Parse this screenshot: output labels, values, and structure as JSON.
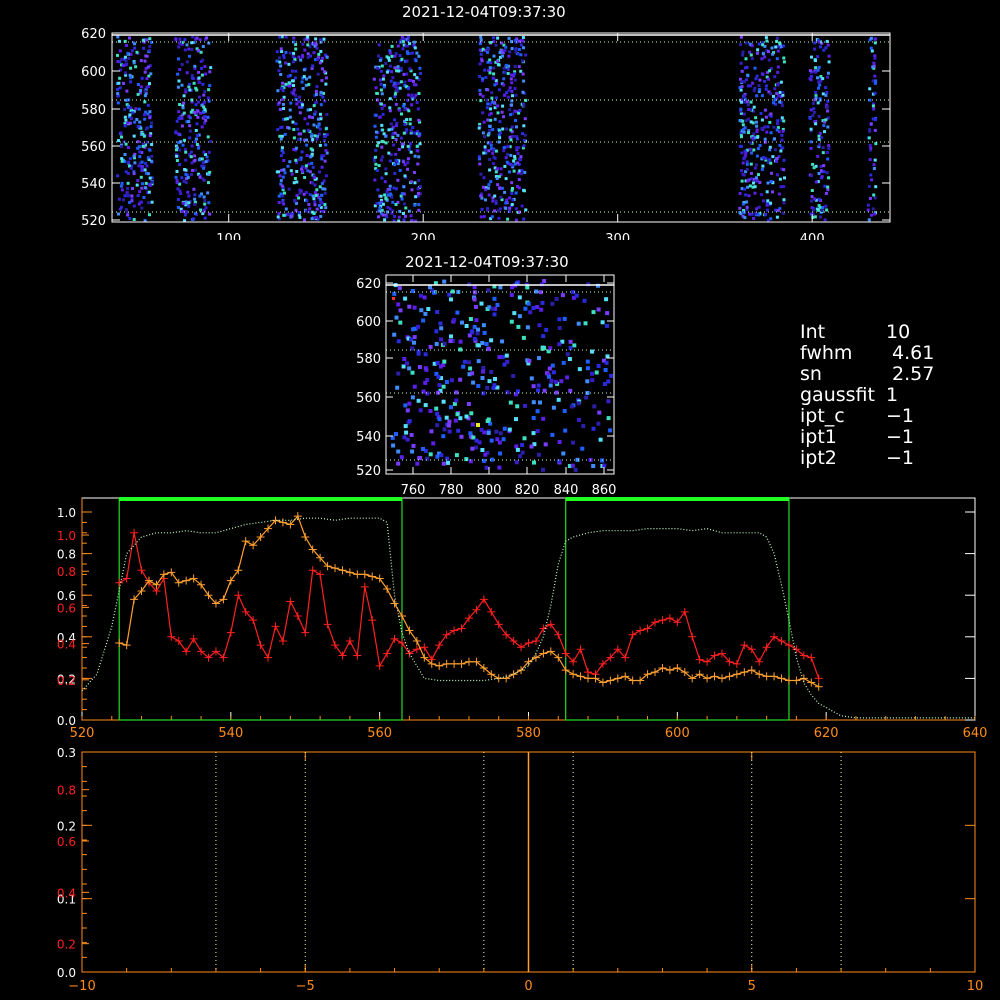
{
  "panels": {
    "top_image": {
      "title": "2021-12-04T09:37:30",
      "x_ticks": [
        "100",
        "200",
        "300",
        "400"
      ],
      "y_ticks": [
        "520",
        "540",
        "560",
        "580",
        "600",
        "620"
      ]
    },
    "mid_image": {
      "title": "2021-12-04T09:37:30",
      "x_ticks": [
        "760",
        "780",
        "800",
        "820",
        "840",
        "860"
      ],
      "y_ticks": [
        "520",
        "540",
        "560",
        "580",
        "600",
        "620"
      ]
    }
  },
  "stats": [
    {
      "key": "Int",
      "value": "10"
    },
    {
      "key": "fwhm",
      "value": " 4.61"
    },
    {
      "key": "sn",
      "value": " 2.57"
    },
    {
      "key": "gaussfit",
      "value": "1"
    },
    {
      "key": "ipt_c",
      "value": "−1"
    },
    {
      "key": "ipt1",
      "value": "−1"
    },
    {
      "key": "ipt2",
      "value": "−1"
    }
  ],
  "colors": {
    "axis_white": "#ffffff",
    "axis_orange": "#ff8c1a",
    "red_series": "#ff2020",
    "orange_series": "#ffa030",
    "green_box": "#22dd22",
    "bright_green_bar": "#22ff22",
    "dotted_green": "#c8ffc8",
    "dotted_yellow": "#ffff88"
  },
  "chart_data": [
    {
      "type": "line",
      "xlim": [
        520,
        640
      ],
      "ylim": [
        0,
        1.0
      ],
      "x_ticks": [
        "520",
        "540",
        "560",
        "580",
        "600",
        "620",
        "640"
      ],
      "y_ticks_white": [
        "0.0",
        "0.2",
        "0.4",
        "0.6",
        "0.8",
        "1.0"
      ],
      "y_ticks_red": [
        "0.2",
        "0.4",
        "0.6",
        "0.8",
        "1.0"
      ],
      "boxes": [
        [
          525,
          563
        ],
        [
          585,
          615
        ]
      ],
      "series": [
        {
          "color": "red",
          "x": [
            525,
            526,
            527,
            528,
            529,
            530,
            531,
            532,
            533,
            534,
            535,
            536,
            537,
            538,
            539,
            540,
            541,
            542,
            543,
            544,
            545,
            546,
            547,
            548,
            549,
            550,
            551,
            552,
            553,
            554,
            555,
            556,
            557,
            558,
            559,
            560,
            561,
            562,
            563,
            564,
            565,
            566,
            567,
            568,
            569,
            570,
            571,
            572,
            573,
            574,
            575,
            576,
            577,
            578,
            579,
            580,
            581,
            582,
            583,
            584,
            585,
            586,
            587,
            588,
            589,
            590,
            591,
            592,
            593,
            594,
            595,
            596,
            597,
            598,
            599,
            600,
            601,
            602,
            603,
            604,
            605,
            606,
            607,
            608,
            609,
            610,
            611,
            612,
            613,
            614,
            615,
            616,
            617,
            618,
            619
          ],
          "y": [
            0.66,
            0.68,
            0.9,
            0.72,
            0.66,
            0.62,
            0.68,
            0.4,
            0.38,
            0.33,
            0.39,
            0.33,
            0.3,
            0.33,
            0.3,
            0.42,
            0.6,
            0.52,
            0.48,
            0.36,
            0.3,
            0.45,
            0.38,
            0.57,
            0.5,
            0.42,
            0.72,
            0.7,
            0.46,
            0.36,
            0.31,
            0.38,
            0.31,
            0.64,
            0.48,
            0.26,
            0.32,
            0.39,
            0.37,
            0.32,
            0.34,
            0.35,
            0.29,
            0.36,
            0.41,
            0.43,
            0.44,
            0.49,
            0.53,
            0.58,
            0.52,
            0.46,
            0.41,
            0.38,
            0.35,
            0.37,
            0.38,
            0.44,
            0.46,
            0.41,
            0.32,
            0.28,
            0.34,
            0.23,
            0.22,
            0.27,
            0.3,
            0.34,
            0.3,
            0.41,
            0.43,
            0.44,
            0.47,
            0.48,
            0.49,
            0.47,
            0.52,
            0.4,
            0.29,
            0.28,
            0.31,
            0.32,
            0.28,
            0.27,
            0.36,
            0.34,
            0.28,
            0.35,
            0.4,
            0.38,
            0.36,
            0.34,
            0.31,
            0.3,
            0.2
          ]
        },
        {
          "color": "orange",
          "x": [
            525,
            526,
            527,
            528,
            529,
            530,
            531,
            532,
            533,
            534,
            535,
            536,
            537,
            538,
            539,
            540,
            541,
            542,
            543,
            544,
            545,
            546,
            547,
            548,
            549,
            550,
            551,
            552,
            553,
            554,
            555,
            556,
            557,
            558,
            559,
            560,
            561,
            562,
            563,
            564,
            565,
            566,
            567,
            568,
            569,
            570,
            571,
            572,
            573,
            574,
            575,
            576,
            577,
            578,
            579,
            580,
            581,
            582,
            583,
            584,
            585,
            586,
            587,
            588,
            589,
            590,
            591,
            592,
            593,
            594,
            595,
            596,
            597,
            598,
            599,
            600,
            601,
            602,
            603,
            604,
            605,
            606,
            607,
            608,
            609,
            610,
            611,
            612,
            613,
            614,
            615,
            616,
            617,
            618,
            619
          ],
          "y": [
            0.37,
            0.36,
            0.58,
            0.62,
            0.67,
            0.65,
            0.7,
            0.71,
            0.66,
            0.67,
            0.68,
            0.65,
            0.6,
            0.56,
            0.58,
            0.67,
            0.72,
            0.86,
            0.84,
            0.88,
            0.92,
            0.96,
            0.95,
            0.94,
            0.98,
            0.88,
            0.82,
            0.78,
            0.74,
            0.73,
            0.72,
            0.71,
            0.7,
            0.7,
            0.69,
            0.68,
            0.63,
            0.56,
            0.5,
            0.43,
            0.38,
            0.3,
            0.27,
            0.26,
            0.27,
            0.27,
            0.27,
            0.28,
            0.28,
            0.25,
            0.22,
            0.2,
            0.2,
            0.22,
            0.24,
            0.28,
            0.3,
            0.32,
            0.33,
            0.3,
            0.24,
            0.22,
            0.21,
            0.2,
            0.2,
            0.18,
            0.19,
            0.2,
            0.21,
            0.19,
            0.19,
            0.22,
            0.23,
            0.25,
            0.24,
            0.25,
            0.23,
            0.2,
            0.22,
            0.2,
            0.21,
            0.2,
            0.21,
            0.22,
            0.23,
            0.24,
            0.22,
            0.21,
            0.21,
            0.2,
            0.19,
            0.19,
            0.2,
            0.18,
            0.16
          ]
        },
        {
          "color": "dotted-green",
          "x": [
            520,
            522,
            524,
            526,
            528,
            530,
            532,
            534,
            536,
            538,
            540,
            542,
            544,
            546,
            548,
            550,
            552,
            554,
            556,
            558,
            560,
            561,
            562,
            563,
            564,
            565,
            566,
            568,
            570,
            572,
            574,
            576,
            578,
            580,
            581,
            582,
            583,
            584,
            585,
            586,
            588,
            590,
            592,
            594,
            596,
            598,
            600,
            602,
            604,
            606,
            608,
            610,
            611,
            612,
            613,
            614,
            615,
            616,
            617,
            618,
            619,
            620,
            621,
            622,
            624,
            628,
            632,
            636,
            640
          ],
          "y": [
            0.14,
            0.22,
            0.45,
            0.8,
            0.88,
            0.9,
            0.9,
            0.91,
            0.9,
            0.9,
            0.92,
            0.94,
            0.95,
            0.96,
            0.96,
            0.97,
            0.97,
            0.96,
            0.97,
            0.97,
            0.97,
            0.95,
            0.6,
            0.42,
            0.32,
            0.26,
            0.2,
            0.19,
            0.19,
            0.19,
            0.19,
            0.2,
            0.22,
            0.26,
            0.32,
            0.4,
            0.55,
            0.75,
            0.86,
            0.88,
            0.9,
            0.91,
            0.91,
            0.91,
            0.92,
            0.92,
            0.92,
            0.91,
            0.92,
            0.9,
            0.9,
            0.9,
            0.9,
            0.88,
            0.8,
            0.65,
            0.48,
            0.3,
            0.18,
            0.12,
            0.08,
            0.06,
            0.04,
            0.02,
            0.01,
            0.01,
            0.01,
            0.01,
            0.01
          ]
        }
      ]
    },
    {
      "type": "line",
      "xlim": [
        -10,
        10
      ],
      "ylim": [
        0,
        0.3
      ],
      "x_ticks": [
        "−10",
        "−5",
        "0",
        "5",
        "10"
      ],
      "y_ticks_white": [
        "0.0",
        "0.1",
        "0.2",
        "0.3"
      ],
      "y_ticks_red": [
        "0.2",
        "0.4",
        "0.6",
        "0.8"
      ],
      "vlines_dotted": [
        -7,
        -5,
        -1,
        1,
        5,
        7
      ],
      "vline_solid": 0
    }
  ]
}
